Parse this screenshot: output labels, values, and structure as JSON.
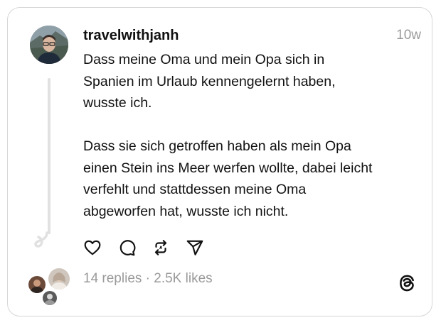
{
  "post": {
    "username": "travelwithjanh",
    "time": "10w",
    "text": "Dass meine Oma und mein Opa sich in\nSpanien im Urlaub kennengelernt haben,\nwusste ich.\n\nDass sie sich getroffen haben als mein Opa\neinen Stein ins Meer werfen wollte, dabei leicht\nverfehlt und stattdessen meine Oma\nabgeworfen hat, wusste ich nicht."
  },
  "actions": {
    "like_icon": "heart-icon",
    "reply_icon": "comment-icon",
    "repost_icon": "repost-icon",
    "share_icon": "send-icon"
  },
  "footer": {
    "stats": "14 replies · 2.5K likes",
    "logo_icon": "threads-logo-icon"
  }
}
